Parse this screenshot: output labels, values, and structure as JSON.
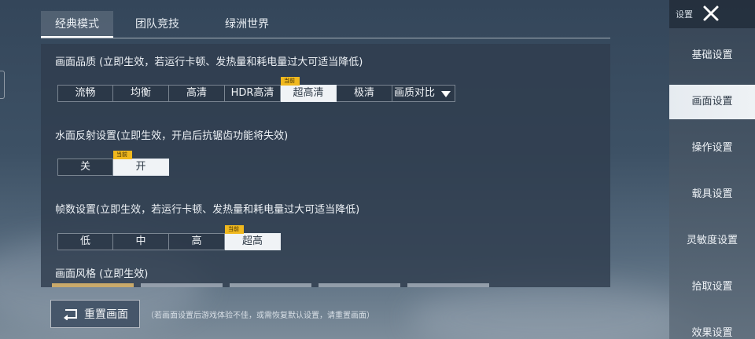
{
  "tabs": [
    {
      "label": "经典模式",
      "active": true
    },
    {
      "label": "团队竞技",
      "active": false
    },
    {
      "label": "绿洲世界",
      "active": false
    }
  ],
  "graphics": {
    "title": "画面品质 (立即生效，若运行卡顿、发热量和耗电量过大可适当降低)",
    "options": [
      "流畅",
      "均衡",
      "高清",
      "HDR高清",
      "超高清",
      "极清"
    ],
    "selected": "超高清",
    "contrast_label": "画质对比"
  },
  "water": {
    "title": "水面反射设置(立即生效，开启后抗锯齿功能将失效)",
    "options": [
      "关",
      "开"
    ],
    "selected": "开"
  },
  "fps": {
    "title": "帧数设置(立即生效，若运行卡顿、发热量和耗电量过大可适当降低)",
    "options": [
      "低",
      "中",
      "高",
      "超高"
    ],
    "selected": "超高"
  },
  "style": {
    "title": "画面风格 (立即生效)"
  },
  "current_badge": "当前",
  "reset": {
    "label": "重置画面",
    "hint": "（若画面设置后游戏体验不佳，或需恢复默认设置，请重置画面）"
  },
  "sidebar": {
    "header": "设置",
    "items": [
      "基础设置",
      "画面设置",
      "操作设置",
      "载具设置",
      "灵敏度设置",
      "拾取设置",
      "效果设置"
    ],
    "active": "画面设置"
  }
}
